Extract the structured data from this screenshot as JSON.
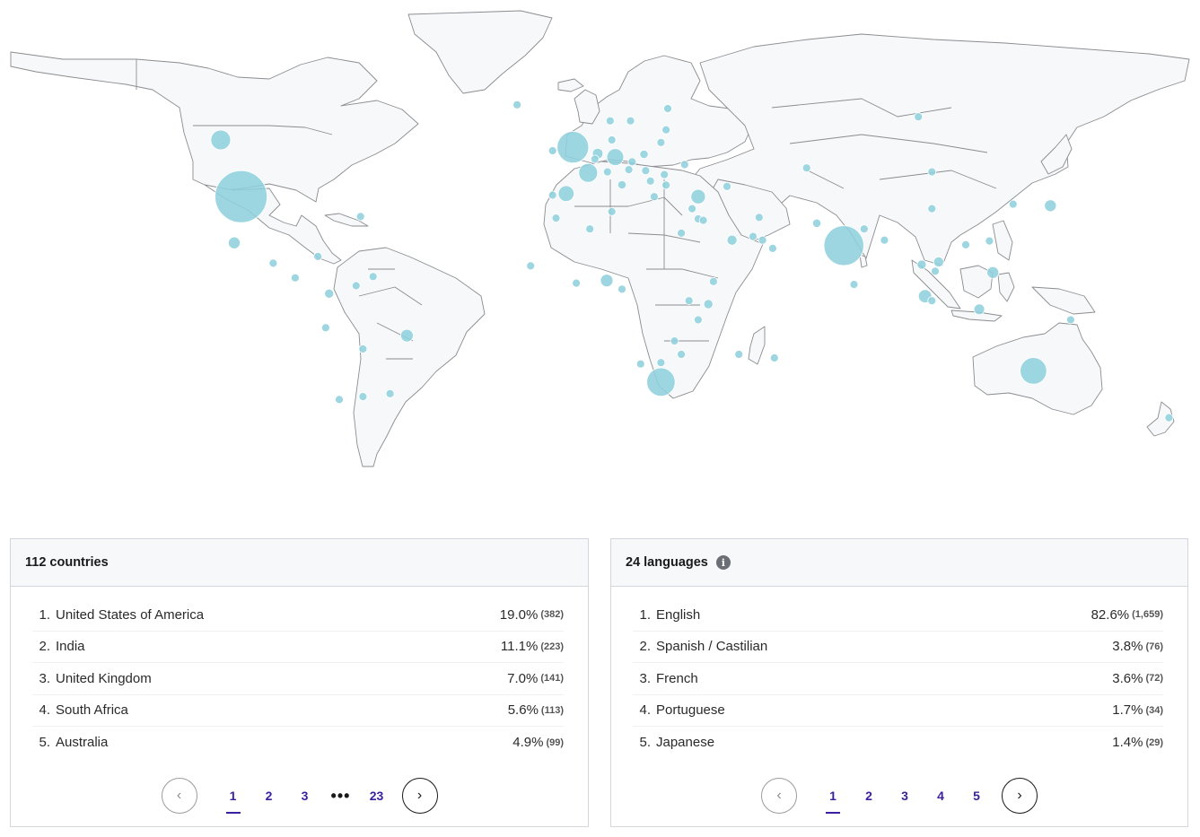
{
  "map": {
    "land_fill": "#f7f8fa",
    "border_color": "#8a8c90",
    "bubble_color": "#8fd0dd",
    "bubbles": [
      {
        "region": "United States of America",
        "lon": -100,
        "lat": 39,
        "value": 382
      },
      {
        "region": "India",
        "lon": 78,
        "lat": 22,
        "value": 223
      },
      {
        "region": "United Kingdom",
        "lon": -2,
        "lat": 54,
        "value": 141
      },
      {
        "region": "South Africa",
        "lon": 24,
        "lat": -29,
        "value": 113
      },
      {
        "region": "Australia",
        "lon": 134,
        "lat": -25,
        "value": 99
      },
      {
        "region": "Canada",
        "lon": -106,
        "lat": 56,
        "value": 55
      },
      {
        "region": "France",
        "lon": 2.5,
        "lat": 46.5,
        "value": 50
      },
      {
        "region": "Germany",
        "lon": 10.5,
        "lat": 51.2,
        "value": 40
      },
      {
        "region": "Spain",
        "lon": -4,
        "lat": 40,
        "value": 35
      },
      {
        "region": "Turkey",
        "lon": 35,
        "lat": 39,
        "value": 30
      },
      {
        "region": "Philippines",
        "lon": 122,
        "lat": 12,
        "value": 20
      },
      {
        "region": "Nigeria",
        "lon": 8,
        "lat": 9,
        "value": 22
      },
      {
        "region": "Brazil",
        "lon": -51,
        "lat": -12,
        "value": 22
      },
      {
        "region": "Malaysia",
        "lon": 102,
        "lat": 3,
        "value": 25
      },
      {
        "region": "Japan",
        "lon": 139,
        "lat": 36,
        "value": 20
      },
      {
        "region": "Mexico",
        "lon": -102,
        "lat": 23,
        "value": 20
      },
      {
        "region": "Indonesia",
        "lon": 118,
        "lat": -2,
        "value": 16
      },
      {
        "region": "Netherlands",
        "lon": 5.3,
        "lat": 52.2,
        "value": 16
      },
      {
        "region": "Belgium",
        "lon": 4.5,
        "lat": 50.6,
        "value": 8
      },
      {
        "region": "Poland",
        "lon": 19,
        "lat": 52,
        "value": 10
      },
      {
        "region": "Sweden",
        "lon": 15,
        "lat": 61,
        "value": 7
      },
      {
        "region": "Ireland",
        "lon": -8,
        "lat": 53,
        "value": 8
      },
      {
        "region": "Italy",
        "lon": 12.5,
        "lat": 42.8,
        "value": 10
      },
      {
        "region": "Kenya",
        "lon": 38,
        "lat": 0,
        "value": 12
      },
      {
        "region": "Saudi Arabia",
        "lon": 45,
        "lat": 24,
        "value": 14
      },
      {
        "region": "Vietnam",
        "lon": 106,
        "lat": 16,
        "value": 14
      },
      {
        "region": "Thailand",
        "lon": 101,
        "lat": 15,
        "value": 12
      },
      {
        "region": "Colombia",
        "lon": -74,
        "lat": 4,
        "value": 12
      },
      {
        "region": "Russia",
        "lon": 100,
        "lat": 62,
        "value": 8
      },
      {
        "region": "China",
        "lon": 104,
        "lat": 35,
        "value": 4
      },
      {
        "region": "South Korea",
        "lon": 128,
        "lat": 36.5,
        "value": 8
      },
      {
        "region": "Pakistan",
        "lon": 70,
        "lat": 30,
        "value": 10
      },
      {
        "region": "Ghana",
        "lon": -1,
        "lat": 8,
        "value": 6
      },
      {
        "region": "Egypt",
        "lon": 30,
        "lat": 26.5,
        "value": 8
      },
      {
        "region": "Morocco",
        "lon": -7,
        "lat": 31.8,
        "value": 8
      },
      {
        "region": "Argentina",
        "lon": -64,
        "lat": -34,
        "value": 6
      },
      {
        "region": "Uruguay",
        "lon": -56,
        "lat": -33,
        "value": 7
      },
      {
        "region": "New Zealand",
        "lon": 174,
        "lat": -41,
        "value": 6
      },
      {
        "region": "Ukraine",
        "lon": 31,
        "lat": 49,
        "value": 8
      },
      {
        "region": "Finland",
        "lon": 26,
        "lat": 64,
        "value": 5
      },
      {
        "region": "Norway",
        "lon": 9,
        "lat": 61,
        "value": 5
      },
      {
        "region": "Denmark",
        "lon": 9.5,
        "lat": 56,
        "value": 5
      },
      {
        "region": "Switzerland",
        "lon": 8.2,
        "lat": 46.8,
        "value": 5
      },
      {
        "region": "Austria",
        "lon": 14.5,
        "lat": 47.5,
        "value": 5
      },
      {
        "region": "Czechia",
        "lon": 15.5,
        "lat": 49.8,
        "value": 5
      },
      {
        "region": "Portugal",
        "lon": -8,
        "lat": 39.5,
        "value": 5
      },
      {
        "region": "Greece",
        "lon": 22,
        "lat": 39,
        "value": 5
      },
      {
        "region": "Romania",
        "lon": 25,
        "lat": 46,
        "value": 5
      },
      {
        "region": "Israel",
        "lon": 35,
        "lat": 31.5,
        "value": 5
      },
      {
        "region": "United Arab Emirates",
        "lon": 54,
        "lat": 24,
        "value": 5
      },
      {
        "region": "Bangladesh",
        "lon": 90,
        "lat": 24,
        "value": 4
      },
      {
        "region": "Nepal",
        "lon": 84,
        "lat": 28,
        "value": 4
      },
      {
        "region": "Sri Lanka",
        "lon": 81,
        "lat": 7.5,
        "value": 4
      },
      {
        "region": "Singapore",
        "lon": 104,
        "lat": 1.3,
        "value": 4
      },
      {
        "region": "Taiwan",
        "lon": 121,
        "lat": 23.7,
        "value": 4
      },
      {
        "region": "Hong Kong",
        "lon": 114,
        "lat": 22.3,
        "value": 4
      },
      {
        "region": "Chile",
        "lon": -71,
        "lat": -35,
        "value": 5
      },
      {
        "region": "Peru",
        "lon": -75,
        "lat": -9,
        "value": 5
      },
      {
        "region": "Venezuela",
        "lon": -66,
        "lat": 7,
        "value": 5
      },
      {
        "region": "Bolivia",
        "lon": -64,
        "lat": -17,
        "value": 3
      },
      {
        "region": "Costa Rica",
        "lon": -84,
        "lat": 10,
        "value": 3
      },
      {
        "region": "Guatemala",
        "lon": -90.5,
        "lat": 15.5,
        "value": 3
      },
      {
        "region": "Jamaica",
        "lon": -77.3,
        "lat": 18,
        "value": 3
      },
      {
        "region": "Trinidad and Tobago",
        "lon": -61,
        "lat": 10.5,
        "value": 3
      },
      {
        "region": "Bermuda",
        "lon": -64.7,
        "lat": 32.3,
        "value": 3
      },
      {
        "region": "Ethiopia",
        "lon": 39.5,
        "lat": 8.6,
        "value": 4
      },
      {
        "region": "Uganda",
        "lon": 32.3,
        "lat": 1.3,
        "value": 3
      },
      {
        "region": "Tanzania",
        "lon": 35,
        "lat": -6,
        "value": 3
      },
      {
        "region": "Zambia",
        "lon": 28,
        "lat": -14,
        "value": 3
      },
      {
        "region": "Zimbabwe",
        "lon": 30,
        "lat": -19,
        "value": 4
      },
      {
        "region": "Botswana",
        "lon": 24,
        "lat": -22,
        "value": 3
      },
      {
        "region": "Namibia",
        "lon": 18,
        "lat": -22.5,
        "value": 3
      },
      {
        "region": "Madagascar",
        "lon": 47,
        "lat": -19,
        "value": 3
      },
      {
        "region": "Mauritius",
        "lon": 57.5,
        "lat": -20.3,
        "value": 3
      },
      {
        "region": "Senegal",
        "lon": -14.5,
        "lat": 14.5,
        "value": 3
      },
      {
        "region": "Cameroon",
        "lon": 12.5,
        "lat": 5.7,
        "value": 4
      },
      {
        "region": "Tunisia",
        "lon": 9.5,
        "lat": 34,
        "value": 3
      },
      {
        "region": "Algeria",
        "lon": 3,
        "lat": 28,
        "value": 3
      },
      {
        "region": "Iran",
        "lon": 53,
        "lat": 32,
        "value": 4
      },
      {
        "region": "Kazakhstan",
        "lon": 67,
        "lat": 48,
        "value": 4
      },
      {
        "region": "Mongolia",
        "lon": 104,
        "lat": 46.8,
        "value": 3
      },
      {
        "region": "Estonia",
        "lon": 25.5,
        "lat": 58.7,
        "value": 3
      },
      {
        "region": "Lithuania",
        "lon": 24,
        "lat": 55.3,
        "value": 3
      },
      {
        "region": "Hungary",
        "lon": 19.5,
        "lat": 47.2,
        "value": 3
      },
      {
        "region": "Serbia",
        "lon": 20.9,
        "lat": 44,
        "value": 3
      },
      {
        "region": "Bulgaria",
        "lon": 25.5,
        "lat": 42.7,
        "value": 3
      },
      {
        "region": "Cyprus",
        "lon": 33.2,
        "lat": 35,
        "value": 3
      },
      {
        "region": "Georgia",
        "lon": 43.5,
        "lat": 42.3,
        "value": 3
      },
      {
        "region": "Jordan",
        "lon": 36.5,
        "lat": 31,
        "value": 3
      },
      {
        "region": "Qatar",
        "lon": 51.2,
        "lat": 25.3,
        "value": 3
      },
      {
        "region": "Oman",
        "lon": 57,
        "lat": 21,
        "value": 3
      },
      {
        "region": "Iceland",
        "lon": -18.5,
        "lat": 64.9,
        "value": 3
      },
      {
        "region": "Cambodia",
        "lon": 105,
        "lat": 12.5,
        "value": 3
      },
      {
        "region": "Papua New Guinea",
        "lon": 145,
        "lat": -6,
        "value": 3
      }
    ]
  },
  "countries": {
    "title": "112 countries",
    "rows": [
      {
        "rank": "1.",
        "name": "United States of America",
        "pct": "19.0%",
        "count": "(382)"
      },
      {
        "rank": "2.",
        "name": "India",
        "pct": "11.1%",
        "count": "(223)"
      },
      {
        "rank": "3.",
        "name": "United Kingdom",
        "pct": "7.0%",
        "count": "(141)"
      },
      {
        "rank": "4.",
        "name": "South Africa",
        "pct": "5.6%",
        "count": "(113)"
      },
      {
        "rank": "5.",
        "name": "Australia",
        "pct": "4.9%",
        "count": "(99)"
      }
    ],
    "pager": {
      "prev": "‹",
      "next": "›",
      "pages": [
        "1",
        "2",
        "3"
      ],
      "ellipsis": "•••",
      "last": "23",
      "active": "1"
    }
  },
  "languages": {
    "title": "24 languages",
    "info_icon": "info-icon",
    "info_glyph": "i",
    "rows": [
      {
        "rank": "1.",
        "name": "English",
        "pct": "82.6%",
        "count": "(1,659)"
      },
      {
        "rank": "2.",
        "name": "Spanish / Castilian",
        "pct": "3.8%",
        "count": "(76)"
      },
      {
        "rank": "3.",
        "name": "French",
        "pct": "3.6%",
        "count": "(72)"
      },
      {
        "rank": "4.",
        "name": "Portuguese",
        "pct": "1.7%",
        "count": "(34)"
      },
      {
        "rank": "5.",
        "name": "Japanese",
        "pct": "1.4%",
        "count": "(29)"
      }
    ],
    "pager": {
      "prev": "‹",
      "next": "›",
      "pages": [
        "1",
        "2",
        "3",
        "4",
        "5"
      ],
      "active": "1"
    }
  },
  "colors": {
    "accent": "#3b1f9e",
    "panel_header_bg": "#f7f8fa",
    "panel_border": "#d3d6dc"
  }
}
